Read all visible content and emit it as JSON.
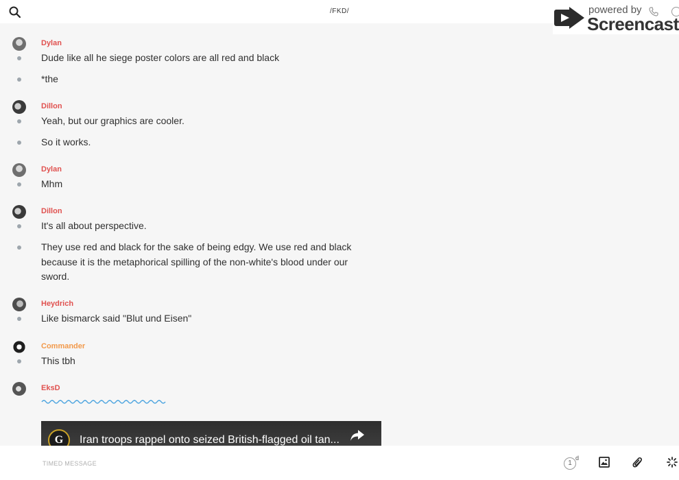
{
  "header": {
    "title": "/FKD/"
  },
  "watermark": {
    "powered_by": "powered by",
    "brand": "Screencastify"
  },
  "sender_colors": {
    "default": "#e0514f",
    "commander": "#f2994a"
  },
  "messages": [
    {
      "sender": "Dylan",
      "lines": [
        "Dude like all he siege poster colors are all red and black",
        "*the"
      ]
    },
    {
      "sender": "Dillon",
      "lines": [
        "Yeah, but our graphics are cooler.",
        "So it works."
      ]
    },
    {
      "sender": "Dylan",
      "lines": [
        "Mhm"
      ]
    },
    {
      "sender": "Dillon",
      "lines": [
        "It's all about perspective.",
        "They use red and black for the sake of being edgy. We use red and black because it is the metaphorical spilling of the non-white's blood under our sword."
      ]
    },
    {
      "sender": "Heydrich",
      "lines": [
        "Like bismarck said \"Blut und Eisen\""
      ]
    },
    {
      "sender": "Commander",
      "lines": [
        "This tbh"
      ]
    },
    {
      "sender": "EksD",
      "lines": []
    }
  ],
  "video_embed": {
    "channel_logo_letter": "G",
    "title": "Iran troops rappel onto seized British-flagged oil tan..."
  },
  "composer": {
    "placeholder": "TIMED MESSAGE",
    "timer_value": "1",
    "timer_unit": "d"
  },
  "icons": [
    "search-icon",
    "screencastify-logo-icon",
    "phone-icon",
    "info-icon",
    "share-icon",
    "image-icon",
    "paperclip-icon",
    "loading-spinner-icon"
  ]
}
